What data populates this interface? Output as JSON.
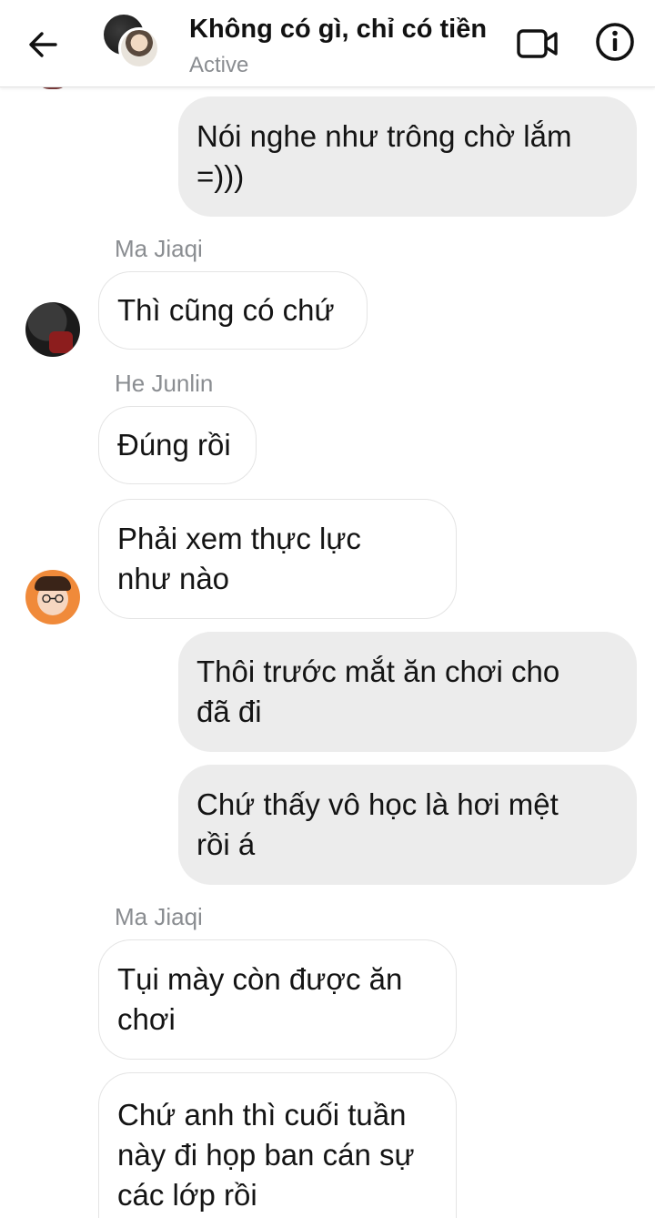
{
  "header": {
    "title": "Không có gì, chỉ có tiền",
    "status": "Active",
    "back_icon": "arrow-left-icon",
    "video_icon": "video-camera-icon",
    "info_icon": "info-icon"
  },
  "messages": [
    {
      "direction": "out",
      "lines": [
        "Nói nghe như trông chờ lắm",
        "=)))"
      ]
    },
    {
      "direction": "in",
      "sender": "Ma Jiaqi",
      "lines": [
        "Thì cũng có chứ"
      ]
    },
    {
      "direction": "in",
      "sender": "He Junlin",
      "lines": [
        "Đúng rồi"
      ]
    },
    {
      "direction": "in",
      "lines": [
        "Phải xem thực lực",
        "như nào"
      ]
    },
    {
      "direction": "out",
      "lines": [
        "Thôi trước mắt ăn chơi cho",
        "đã đi"
      ]
    },
    {
      "direction": "out",
      "lines": [
        "Chứ thấy vô học là hơi mệt",
        "rồi á"
      ]
    },
    {
      "direction": "in",
      "sender": "Ma Jiaqi",
      "lines": [
        "Tụi mày còn được ăn",
        "chơi"
      ]
    },
    {
      "direction": "in",
      "lines": [
        "Chứ anh thì cuối tuần",
        "này đi họp ban cán sự",
        "các lớp rồi"
      ]
    }
  ],
  "colors": {
    "outgoing_bubble": "#ececec",
    "incoming_bubble_border": "#e4e4e4",
    "secondary_text": "#8a8d91"
  }
}
